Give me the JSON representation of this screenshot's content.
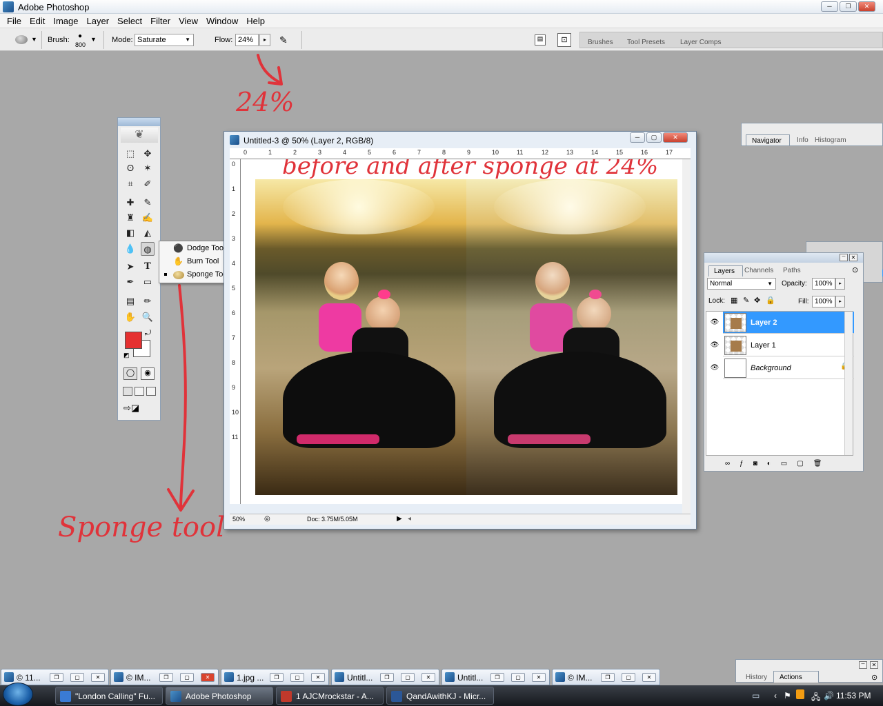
{
  "app": {
    "title": "Adobe Photoshop"
  },
  "menu": [
    "File",
    "Edit",
    "Image",
    "Layer",
    "Select",
    "Filter",
    "View",
    "Window",
    "Help"
  ],
  "options": {
    "brush_label": "Brush:",
    "brush_size": "800",
    "mode_label": "Mode:",
    "mode_value": "Saturate",
    "flow_label": "Flow:",
    "flow_value": "24%"
  },
  "palette_well": {
    "tabs": [
      "Brushes",
      "Tool Presets",
      "Layer Comps"
    ]
  },
  "annotations": {
    "flow_note": "24%",
    "title_note": "before and after sponge at 24%",
    "tool_note": "Sponge tool"
  },
  "flyout": {
    "items": [
      {
        "label": "Dodge Tool",
        "selected": false
      },
      {
        "label": "Burn Tool",
        "selected": false
      },
      {
        "label": "Sponge Tool",
        "selected": true
      }
    ]
  },
  "document": {
    "title": "Untitled-3 @ 50% (Layer 2, RGB/8)",
    "ruler_top": [
      "0",
      "1",
      "2",
      "3",
      "4",
      "5",
      "6",
      "7",
      "8",
      "9",
      "10",
      "11",
      "12",
      "13",
      "14",
      "15",
      "16",
      "17"
    ],
    "ruler_left": [
      "0",
      "1",
      "2",
      "3",
      "4",
      "5",
      "6",
      "7",
      "8",
      "9",
      "10",
      "11"
    ],
    "zoom": "50%",
    "doc_size": "Doc: 3.75M/5.05M"
  },
  "navigator_panel": {
    "tabs": [
      "Navigator",
      "Info",
      "Histogram"
    ]
  },
  "layers_panel": {
    "tabs": [
      "Layers",
      "Channels",
      "Paths"
    ],
    "blend_mode": "Normal",
    "opacity_label": "Opacity:",
    "opacity_value": "100%",
    "lock_label": "Lock:",
    "fill_label": "Fill:",
    "fill_value": "100%",
    "layers": [
      {
        "name": "Layer 2",
        "selected": true
      },
      {
        "name": "Layer 1",
        "selected": false
      },
      {
        "name": "Background",
        "selected": false,
        "locked": true
      }
    ]
  },
  "history_panel": {
    "tabs": [
      "History",
      "Actions"
    ]
  },
  "minimized_windows": [
    "© 11...",
    "© IM...",
    "1.jpg ...",
    "Untitl...",
    "Untitl...",
    "© IM..."
  ],
  "taskbar": {
    "buttons": [
      "\"London Calling\" Fu...",
      "Adobe Photoshop",
      "1 AJCMrockstar - A...",
      "QandAwithKJ - Micr..."
    ],
    "clock": "11:53 PM"
  },
  "colors": {
    "foreground": "#e53030",
    "background": "#ffffff",
    "selection": "#3399ff",
    "annotation": "#e0333a"
  }
}
